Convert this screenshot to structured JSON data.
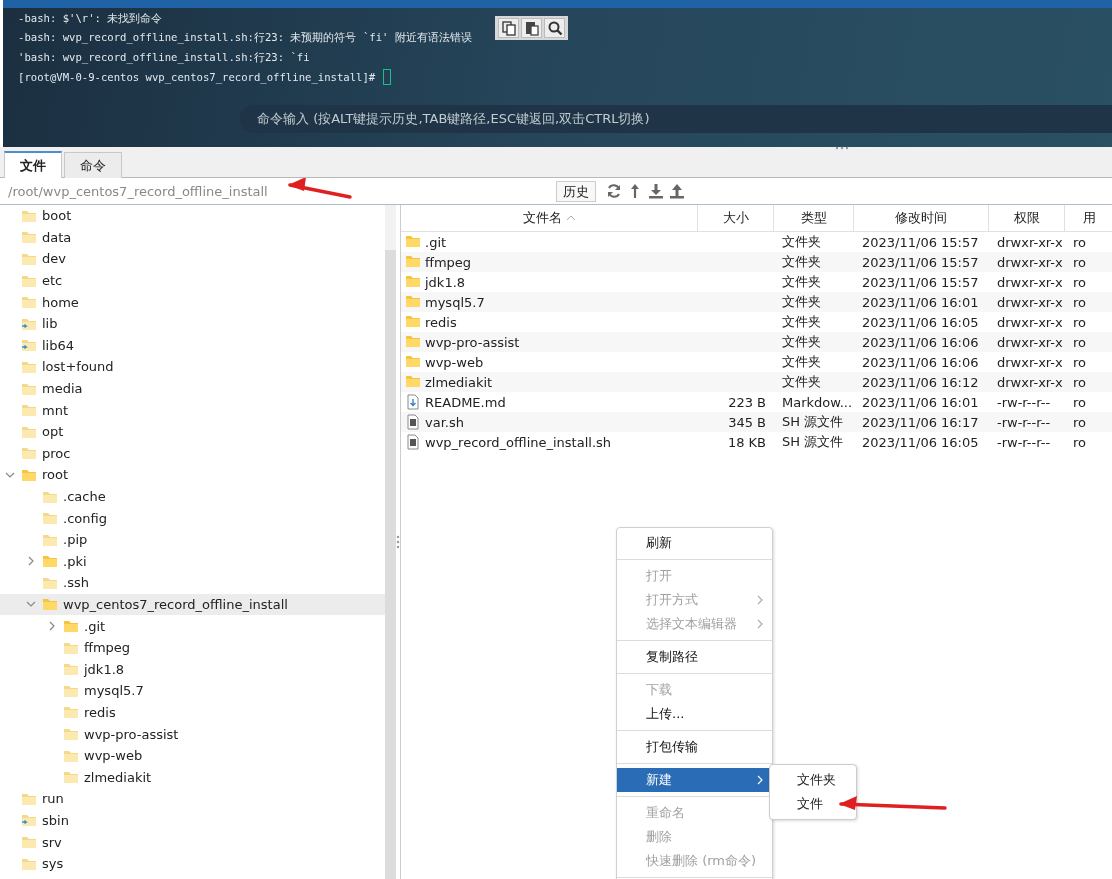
{
  "terminal": {
    "lines": [
      "-bash: $'\\r': 未找到命令",
      "-bash: wvp_record_offline_install.sh:行23: 未预期的符号 `fi' 附近有语法错误",
      "'bash: wvp_record_offline_install.sh:行23: `fi",
      "[root@VM-0-9-centos wvp_centos7_record_offline_install]#"
    ],
    "command_hint": "命令输入 (按ALT键提示历史,TAB键路径,ESC键返回,双击CTRL切换)"
  },
  "tabs": [
    {
      "label": "文件",
      "selected": true
    },
    {
      "label": "命令",
      "selected": false
    }
  ],
  "path_bar": {
    "path": "/root/wvp_centos7_record_offline_install",
    "history_button": "历史"
  },
  "tree": [
    {
      "label": "boot",
      "kind": "folder",
      "selected": false
    },
    {
      "label": "data",
      "kind": "folder",
      "selected": false
    },
    {
      "label": "dev",
      "kind": "folder",
      "selected": false
    },
    {
      "label": "etc",
      "kind": "folder",
      "selected": false
    },
    {
      "label": "home",
      "kind": "folder",
      "selected": false
    },
    {
      "label": "lib",
      "kind": "link",
      "selected": false
    },
    {
      "label": "lib64",
      "kind": "link",
      "selected": false
    },
    {
      "label": "lost+found",
      "kind": "folder",
      "selected": false
    },
    {
      "label": "media",
      "kind": "folder",
      "selected": false
    },
    {
      "label": "mnt",
      "kind": "folder",
      "selected": false
    },
    {
      "label": "opt",
      "kind": "folder",
      "selected": false
    },
    {
      "label": "proc",
      "kind": "folder",
      "selected": false
    },
    {
      "label": "root",
      "kind": "folder",
      "selected": false,
      "expanded": true,
      "children": [
        {
          "label": ".cache",
          "kind": "folder",
          "selected": false
        },
        {
          "label": ".config",
          "kind": "folder",
          "selected": false
        },
        {
          "label": ".pip",
          "kind": "folder",
          "selected": false
        },
        {
          "label": ".pki",
          "kind": "folder",
          "selected": false,
          "expanded": false
        },
        {
          "label": ".ssh",
          "kind": "folder",
          "selected": false
        },
        {
          "label": "wvp_centos7_record_offline_install",
          "kind": "folder",
          "selected": true,
          "expanded": true,
          "children": [
            {
              "label": ".git",
              "kind": "folder",
              "selected": false,
              "expanded": false
            },
            {
              "label": "ffmpeg",
              "kind": "folder",
              "selected": false
            },
            {
              "label": "jdk1.8",
              "kind": "folder",
              "selected": false
            },
            {
              "label": "mysql5.7",
              "kind": "folder",
              "selected": false
            },
            {
              "label": "redis",
              "kind": "folder",
              "selected": false
            },
            {
              "label": "wvp-pro-assist",
              "kind": "folder",
              "selected": false
            },
            {
              "label": "wvp-web",
              "kind": "folder",
              "selected": false
            },
            {
              "label": "zlmediakit",
              "kind": "folder",
              "selected": false
            }
          ]
        }
      ]
    },
    {
      "label": "run",
      "kind": "folder",
      "selected": false
    },
    {
      "label": "sbin",
      "kind": "link",
      "selected": false
    },
    {
      "label": "srv",
      "kind": "folder",
      "selected": false
    },
    {
      "label": "sys",
      "kind": "folder",
      "selected": false
    }
  ],
  "table": {
    "columns": [
      {
        "label": "文件名",
        "sorted": true
      },
      {
        "label": "大小",
        "sorted": false
      },
      {
        "label": "类型",
        "sorted": false
      },
      {
        "label": "修改时间",
        "sorted": false
      },
      {
        "label": "权限",
        "sorted": false
      },
      {
        "label": "用",
        "sorted": false
      }
    ],
    "rows": [
      {
        "kind": "folder",
        "name": ".git",
        "type": "文件夹",
        "modified": "2023/11/06 15:57",
        "permissions": "drwxr-xr-x",
        "column_6": "ro"
      },
      {
        "kind": "folder",
        "name": "ffmpeg",
        "type": "文件夹",
        "modified": "2023/11/06 15:57",
        "permissions": "drwxr-xr-x",
        "column_6": "ro"
      },
      {
        "kind": "folder",
        "name": "jdk1.8",
        "type": "文件夹",
        "modified": "2023/11/06 15:57",
        "permissions": "drwxr-xr-x",
        "column_6": "ro"
      },
      {
        "kind": "folder",
        "name": "mysql5.7",
        "type": "文件夹",
        "modified": "2023/11/06 16:01",
        "permissions": "drwxr-xr-x",
        "column_6": "ro"
      },
      {
        "kind": "folder",
        "name": "redis",
        "type": "文件夹",
        "modified": "2023/11/06 16:05",
        "permissions": "drwxr-xr-x",
        "column_6": "ro"
      },
      {
        "kind": "folder",
        "name": "wvp-pro-assist",
        "type": "文件夹",
        "modified": "2023/11/06 16:06",
        "permissions": "drwxr-xr-x",
        "column_6": "ro"
      },
      {
        "kind": "folder",
        "name": "wvp-web",
        "type": "文件夹",
        "modified": "2023/11/06 16:06",
        "permissions": "drwxr-xr-x",
        "column_6": "ro"
      },
      {
        "kind": "folder",
        "name": "zlmediakit",
        "type": "文件夹",
        "modified": "2023/11/06 16:12",
        "permissions": "drwxr-xr-x",
        "column_6": "ro"
      },
      {
        "kind": "markdown",
        "name": "README.md",
        "size": "223 B",
        "type": "Markdow...",
        "modified": "2023/11/06 16:01",
        "permissions": "-rw-r--r--",
        "column_6": "ro"
      },
      {
        "kind": "script",
        "name": "var.sh",
        "size": "345 B",
        "type": "SH 源文件",
        "modified": "2023/11/06 16:17",
        "permissions": "-rw-r--r--",
        "column_6": "ro"
      },
      {
        "kind": "script",
        "name": "wvp_record_offline_install.sh",
        "size": "18 KB",
        "type": "SH 源文件",
        "modified": "2023/11/06 16:05",
        "permissions": "-rw-r--r--",
        "column_6": "ro"
      }
    ]
  },
  "context_menu": {
    "items": [
      {
        "kind": "item",
        "label": "刷新",
        "disabled": false,
        "submenu": false,
        "selected": false
      },
      {
        "kind": "separator"
      },
      {
        "kind": "item",
        "label": "打开",
        "disabled": true,
        "submenu": false,
        "selected": false
      },
      {
        "kind": "item",
        "label": "打开方式",
        "disabled": true,
        "submenu": true,
        "selected": false
      },
      {
        "kind": "item",
        "label": "选择文本编辑器",
        "disabled": true,
        "submenu": true,
        "selected": false
      },
      {
        "kind": "separator"
      },
      {
        "kind": "item",
        "label": "复制路径",
        "disabled": false,
        "submenu": false,
        "selected": false
      },
      {
        "kind": "separator"
      },
      {
        "kind": "item",
        "label": "下载",
        "disabled": true,
        "submenu": false,
        "selected": false
      },
      {
        "kind": "item",
        "label": "上传...",
        "disabled": false,
        "submenu": false,
        "selected": false
      },
      {
        "kind": "separator"
      },
      {
        "kind": "item",
        "label": "打包传输",
        "disabled": false,
        "submenu": false,
        "selected": false
      },
      {
        "kind": "separator"
      },
      {
        "kind": "item",
        "label": "新建",
        "disabled": false,
        "submenu": true,
        "selected": true
      },
      {
        "kind": "separator"
      },
      {
        "kind": "item",
        "label": "重命名",
        "disabled": true,
        "submenu": false,
        "selected": false
      },
      {
        "kind": "item",
        "label": "删除",
        "disabled": true,
        "submenu": false,
        "selected": false
      },
      {
        "kind": "item",
        "label": "快速删除 (rm命令)",
        "disabled": true,
        "submenu": false,
        "selected": false
      },
      {
        "kind": "separator"
      }
    ]
  },
  "submenu": {
    "items": [
      {
        "label": "文件夹"
      },
      {
        "label": "文件"
      }
    ]
  }
}
